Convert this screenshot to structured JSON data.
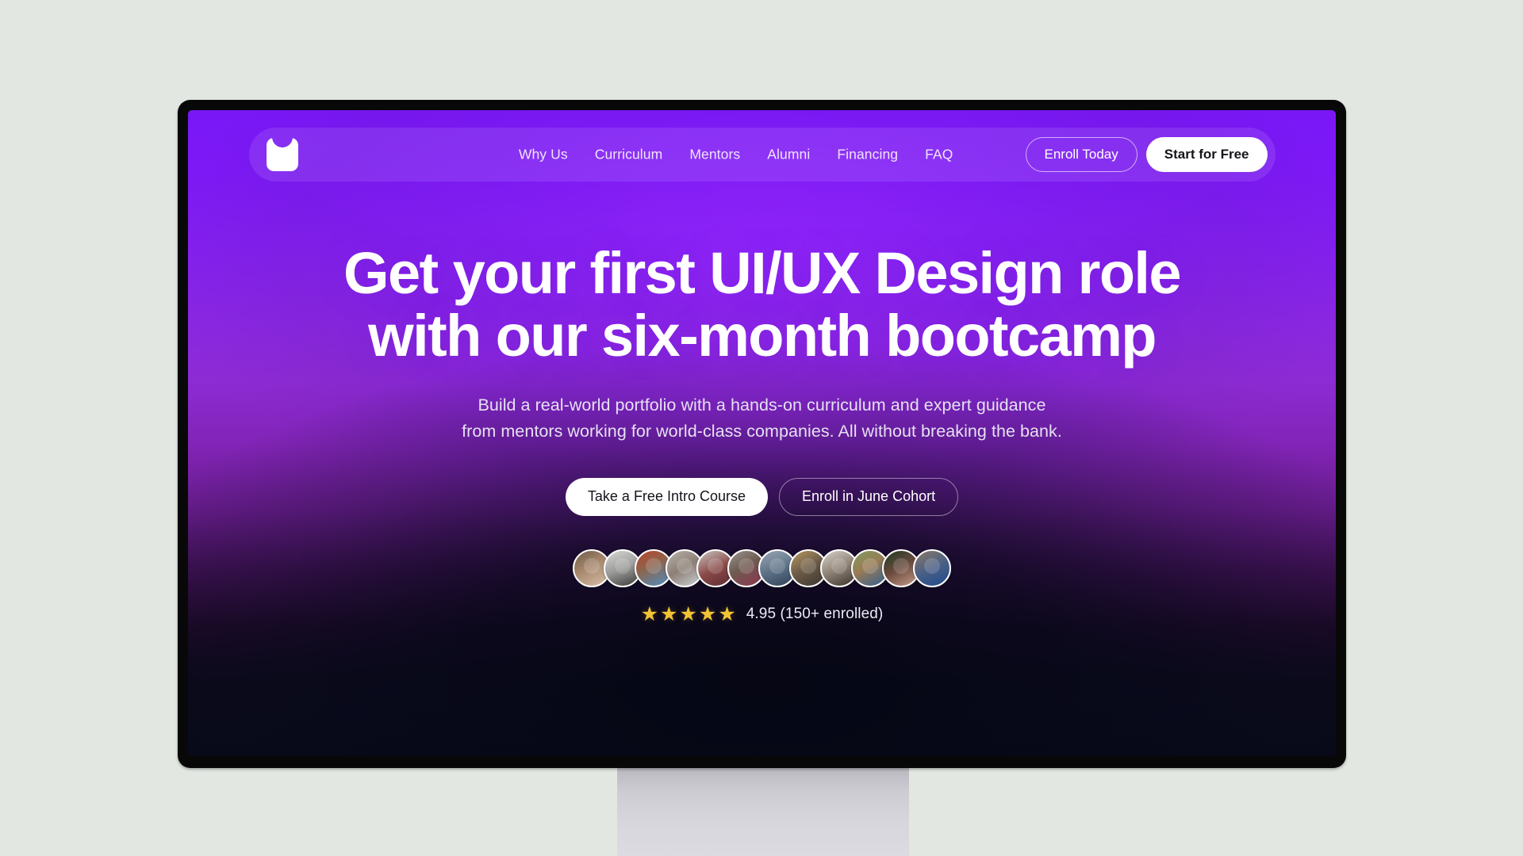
{
  "scene": {
    "background_color": "#e2e7e2",
    "device": "desktop-monitor",
    "bezel_color": "#080808",
    "stand_color": "#d4d3d9"
  },
  "screen": {
    "gradient_top": "#7a17f7",
    "gradient_mid": "#8d2bd4",
    "gradient_bottom": "#080a18"
  },
  "nav": {
    "logo_name": "brand-logo-mark",
    "links": [
      {
        "label": "Why Us"
      },
      {
        "label": "Curriculum"
      },
      {
        "label": "Mentors"
      },
      {
        "label": "Alumni"
      },
      {
        "label": "Financing"
      },
      {
        "label": "FAQ"
      }
    ],
    "enroll_label": "Enroll Today",
    "start_free_label": "Start for Free"
  },
  "hero": {
    "headline_line1": "Get your first UI/UX Design role",
    "headline_line2": "with our six-month bootcamp",
    "sub_line1": "Build a real-world portfolio with a hands-on curriculum and expert guidance",
    "sub_line2": "from mentors working for world-class companies. All without breaking the bank.",
    "cta_primary": "Take a Free Intro Course",
    "cta_secondary": "Enroll in June Cohort"
  },
  "social_proof": {
    "avatars": [
      {
        "name": "student-avatar-1",
        "bg": "linear-gradient(150deg,#6d5a47 0%,#a4856a 42%,#d8c0a8 100%)"
      },
      {
        "name": "student-avatar-2",
        "bg": "linear-gradient(160deg,#d8d8d6 0%,#9b9b99 50%,#3a3a38 100%)"
      },
      {
        "name": "student-avatar-3",
        "bg": "linear-gradient(155deg,#b9452a 0%,#8a6550 45%,#4f8fc4 100%)"
      },
      {
        "name": "student-avatar-4",
        "bg": "linear-gradient(150deg,#b8b3ad 0%,#8d7f75 48%,#cfd4da 100%)"
      },
      {
        "name": "student-avatar-5",
        "bg": "linear-gradient(155deg,#c9c7c2 0%,#8a4a48 52%,#5b2b33 100%)"
      },
      {
        "name": "student-avatar-6",
        "bg": "linear-gradient(150deg,#9a9791 0%,#6e5a50 45%,#8e3550 100%)"
      },
      {
        "name": "student-avatar-7",
        "bg": "linear-gradient(160deg,#9aa7b4 0%,#5f7388 50%,#2f4156 100%)"
      },
      {
        "name": "student-avatar-8",
        "bg": "linear-gradient(150deg,#b99a63 0%,#6b5a46 48%,#3a3632 100%)"
      },
      {
        "name": "student-avatar-9",
        "bg": "linear-gradient(155deg,#d7d3cc 0%,#8f8275 50%,#38322c 100%)"
      },
      {
        "name": "student-avatar-10",
        "bg": "linear-gradient(150deg,#7f9c5e 0%,#9a7b55 45%,#2f5f93 100%)"
      },
      {
        "name": "student-avatar-11",
        "bg": "linear-gradient(150deg,#1d3a22 0%,#6a4a3e 48%,#caa08c 100%)"
      },
      {
        "name": "student-avatar-12",
        "bg": "linear-gradient(155deg,#8a7a64 0%,#4a5f86 50%,#1f4a8c 100%)"
      }
    ],
    "star_count": 5,
    "star_glyph": "★",
    "star_color": "#f2c335",
    "rating_text": "4.95 (150+ enrolled)"
  }
}
